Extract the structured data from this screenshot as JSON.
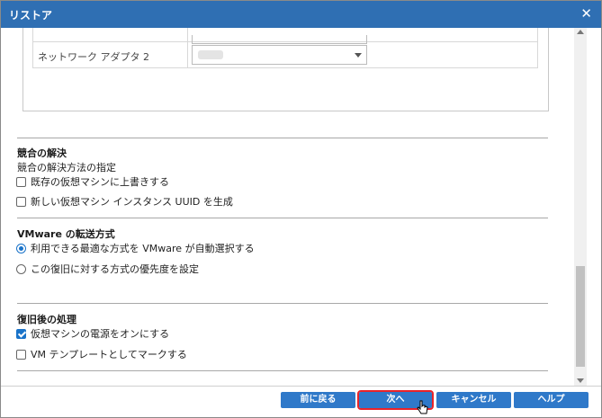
{
  "window": {
    "title": "リストア",
    "close_glyph": "✕"
  },
  "network": {
    "adapter_label": "ネットワーク アダプタ 2",
    "adapter_value": ""
  },
  "conflict": {
    "heading": "競合の解決",
    "subheading": "競合の解決方法の指定",
    "options": [
      {
        "label": "既存の仮想マシンに上書きする",
        "checked": false
      },
      {
        "label": "新しい仮想マシン インスタンス UUID を生成",
        "checked": false
      }
    ]
  },
  "transport": {
    "heading": "VMware の転送方式",
    "options": [
      {
        "label": "利用できる最適な方式を VMware が自動選択する",
        "selected": true
      },
      {
        "label": "この復旧に対する方式の優先度を設定",
        "selected": false
      }
    ]
  },
  "post": {
    "heading": "復旧後の処理",
    "options": [
      {
        "label": "仮想マシンの電源をオンにする",
        "checked": true
      },
      {
        "label": "VM テンプレートとしてマークする",
        "checked": false
      }
    ]
  },
  "footer": {
    "back_label": "前に戻る",
    "next_label": "次へ",
    "cancel_label": "キャンセル",
    "help_label": "ヘルプ"
  },
  "colors": {
    "accent": "#2f79c9",
    "titlebar": "#2f6fb3",
    "highlight": "#e8232a"
  }
}
